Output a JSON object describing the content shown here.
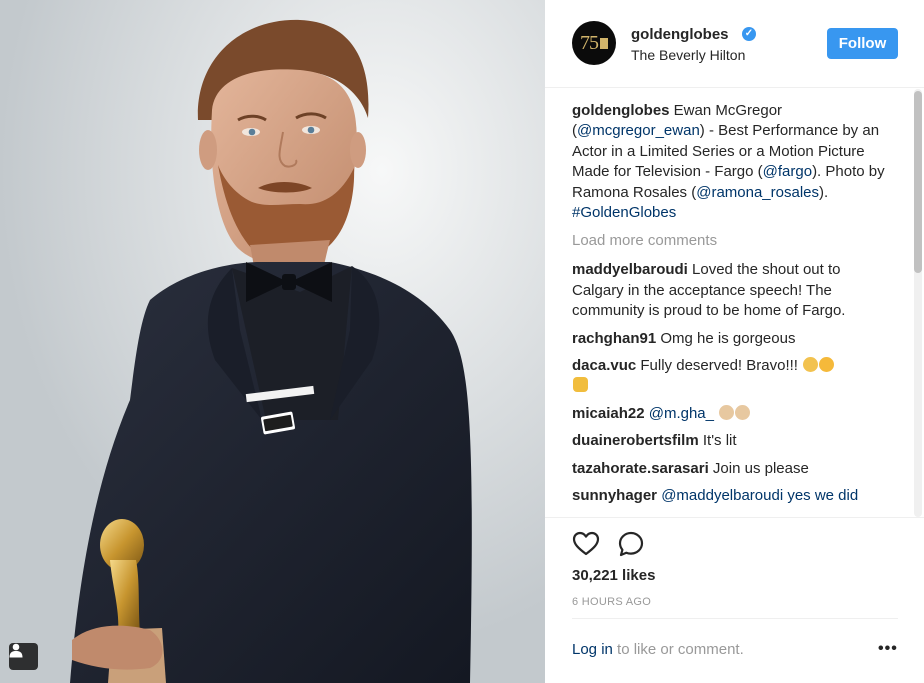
{
  "post": {
    "username": "goldenglobes",
    "avatar_text": "75",
    "verified_icon": "verified-badge-icon",
    "location": "The Beverly Hilton",
    "follow_label": "Follow",
    "pin_text": "TIME'S UP",
    "accent_color": "#3897f0",
    "link_color": "#003569"
  },
  "caption": {
    "user": "goldenglobes",
    "pre": "Ewan McGregor (",
    "mention1": "@mcgregor_ewan",
    "mid1": ") - Best Performance by an Actor in a Limited Series or a Motion Picture Made for Television - Fargo (",
    "mention2": "@fargo",
    "mid2": "). Photo by Ramona Rosales (",
    "mention3": "@ramona_rosales",
    "mid3": ").",
    "hashtag": "#GoldenGlobes"
  },
  "load_more": "Load more comments",
  "comments": [
    {
      "user": "maddyelbaroudi",
      "text": "Loved the shout out to Calgary in the acceptance speech! The community is proud to be home of Fargo."
    },
    {
      "user": "rachghan91",
      "text": "Omg he is gorgeous"
    },
    {
      "user": "daca.vuc",
      "text": "Fully deserved! Bravo!!!"
    },
    {
      "user": "micaiah22",
      "text": "@m.gha_"
    },
    {
      "user": "duainerobertsfilm",
      "text": "It's lit"
    },
    {
      "user": "tazahorate.sarasari",
      "text": "Join us please"
    },
    {
      "user": "sunnyhager",
      "text": "@maddyelbaroudi yes we did"
    }
  ],
  "actions": {
    "like_icon": "heart-icon",
    "comment_icon": "comment-icon",
    "likes": "30,221 likes",
    "time": "6 HOURS AGO"
  },
  "footer": {
    "login_link": "Log in",
    "login_rest": " to like or comment.",
    "more_label": "•••"
  }
}
